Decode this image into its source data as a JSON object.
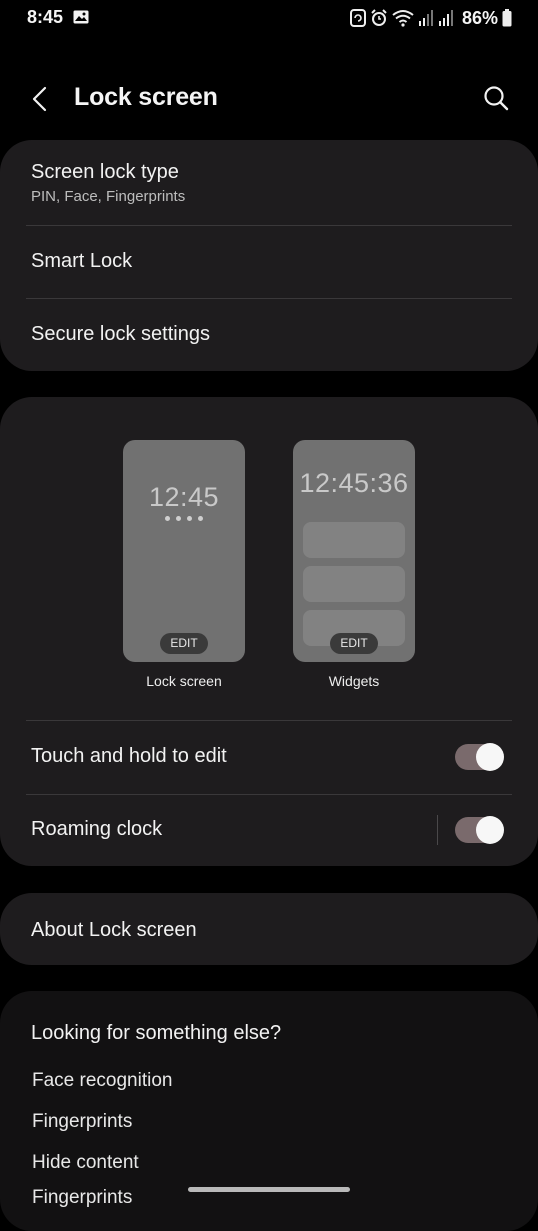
{
  "status_bar": {
    "time": "8:45",
    "battery": "86%"
  },
  "app_bar": {
    "title": "Lock screen"
  },
  "security_card": {
    "screen_lock_type": {
      "title": "Screen lock type",
      "subtitle": "PIN, Face, Fingerprints"
    },
    "smart_lock": "Smart Lock",
    "secure_lock_settings": "Secure lock settings"
  },
  "preview_card": {
    "lock_preview": {
      "clock": "12:45",
      "edit": "EDIT",
      "label": "Lock screen"
    },
    "widgets_preview": {
      "clock": "12:45:36",
      "edit": "EDIT",
      "label": "Widgets"
    },
    "touch_hold": {
      "label": "Touch and hold to edit",
      "on": true
    },
    "roaming_clock": {
      "label": "Roaming clock",
      "on": true
    }
  },
  "about": "About Lock screen",
  "suggestions": {
    "heading": "Looking for something else?",
    "links": [
      "Face recognition",
      "Fingerprints",
      "Hide content",
      "Fingerprints"
    ]
  },
  "colors": {
    "background": "#000000",
    "card": "#1e1c1e",
    "toggle_track": "#7a6a6c"
  }
}
